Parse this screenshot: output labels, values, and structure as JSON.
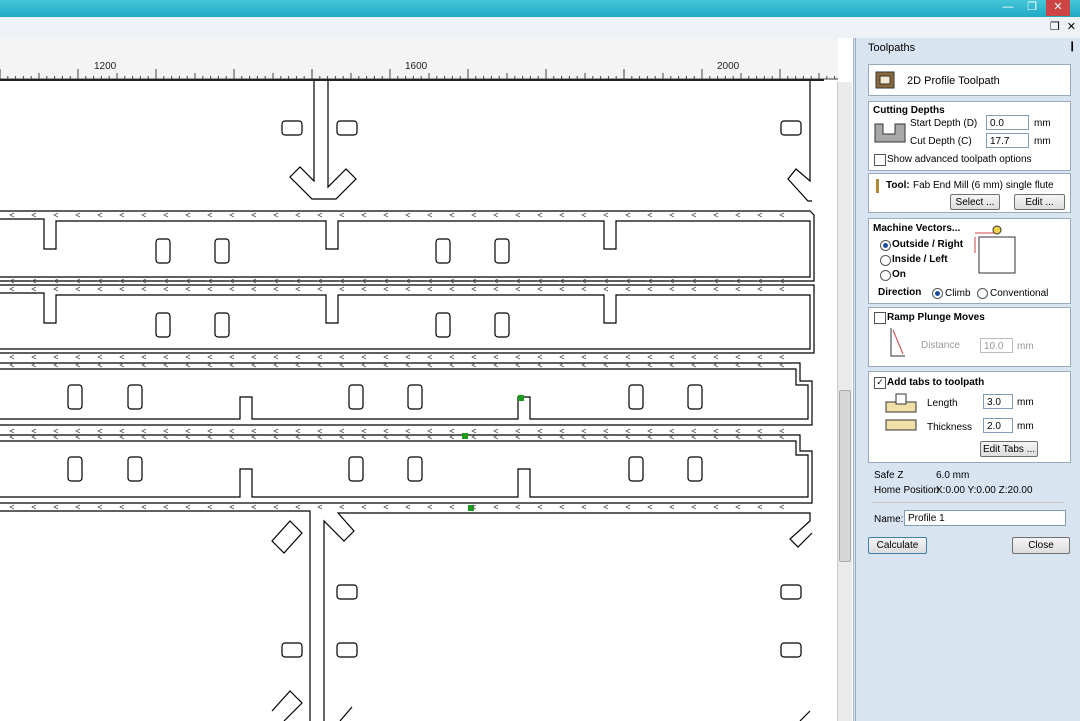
{
  "window": {
    "minimize_glyph": "—",
    "restore_glyph": "❐",
    "close_glyph": "✕",
    "mdi_restore_glyph": "❐",
    "mdi_close_glyph": "✕"
  },
  "ruler": {
    "labels": [
      "1200",
      "1600",
      "2000"
    ]
  },
  "panel": {
    "title": "Toolpaths",
    "pin_icon": "pin-icon",
    "header_title": "2D Profile Toolpath",
    "cutting_depths": {
      "title": "Cutting Depths",
      "start_label": "Start Depth (D)",
      "start_value": "0.0",
      "start_unit": "mm",
      "cut_label": "Cut Depth (C)",
      "cut_value": "17.7",
      "cut_unit": "mm",
      "advanced_label": "Show advanced toolpath options"
    },
    "tool": {
      "label": "Tool:",
      "value": "Fab End Mill (6 mm) single flute",
      "select_btn": "Select ...",
      "edit_btn": "Edit ..."
    },
    "machine_vectors": {
      "title": "Machine Vectors...",
      "options": [
        "Outside / Right",
        "Inside / Left",
        "On"
      ],
      "selected": "Outside / Right",
      "direction_label": "Direction",
      "direction_options": [
        "Climb",
        "Conventional"
      ],
      "direction_selected": "Climb"
    },
    "ramp": {
      "label": "Ramp Plunge Moves",
      "checked": false,
      "distance_label": "Distance",
      "distance_value": "10.0",
      "distance_unit": "mm"
    },
    "tabs": {
      "label": "Add tabs to toolpath",
      "checked": true,
      "length_label": "Length",
      "length_value": "3.0",
      "length_unit": "mm",
      "thickness_label": "Thickness",
      "thickness_value": "2.0",
      "thickness_unit": "mm",
      "edit_tabs_btn": "Edit Tabs ..."
    },
    "info": {
      "safe_z_label": "Safe Z",
      "safe_z_value": "6.0 mm",
      "home_label": "Home Position",
      "home_value": "X:0.00 Y:0.00 Z:20.00"
    },
    "name_label": "Name:",
    "name_value": "Profile 1",
    "calculate_btn": "Calculate",
    "close_btn": "Close"
  }
}
